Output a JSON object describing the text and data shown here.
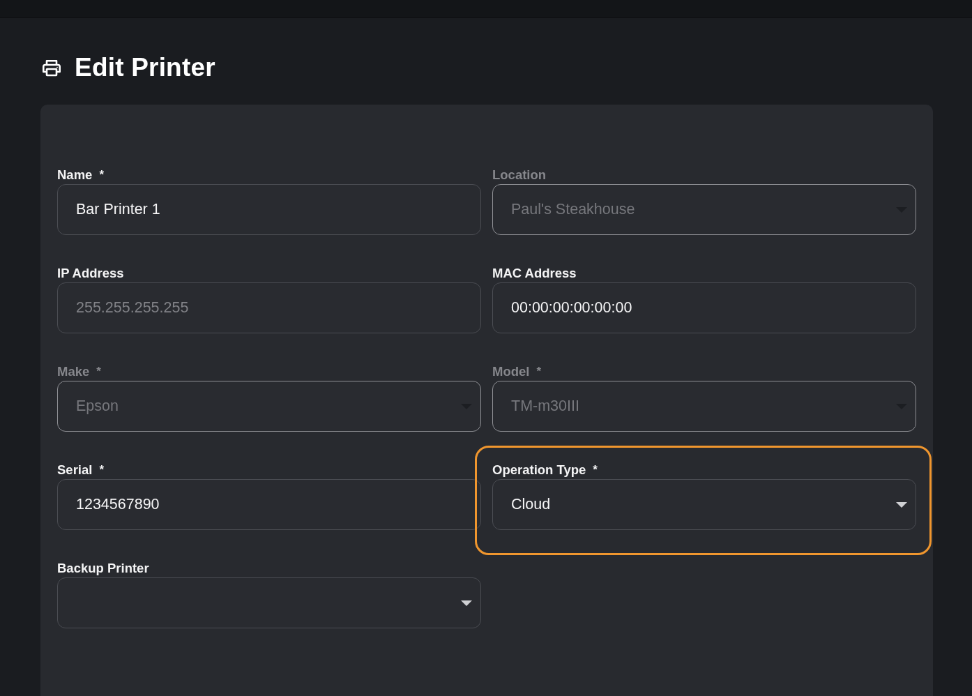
{
  "page": {
    "title": "Edit Printer"
  },
  "form": {
    "fields": [
      {
        "label": "Name",
        "required_mark": "*",
        "kind": "text",
        "value": "Bar Printer 1",
        "disabled": false,
        "highlighted": false
      },
      {
        "label": "Location",
        "kind": "select",
        "value": "Paul's Steakhouse",
        "disabled": true,
        "highlighted": false
      },
      {
        "label": "IP Address",
        "kind": "text",
        "placeholder": "255.255.255.255",
        "disabled": false,
        "highlighted": false
      },
      {
        "label": "MAC Address",
        "kind": "text",
        "value": "00:00:00:00:00:00",
        "disabled": false,
        "highlighted": false
      },
      {
        "label": "Make",
        "required_mark": "*",
        "kind": "select",
        "value": "Epson",
        "disabled": true,
        "highlighted": false
      },
      {
        "label": "Model",
        "required_mark": "*",
        "kind": "select",
        "value": "TM-m30III",
        "disabled": true,
        "highlighted": false
      },
      {
        "label": "Serial",
        "required_mark": "*",
        "kind": "text",
        "value": "1234567890",
        "disabled": false,
        "highlighted": false
      },
      {
        "label": "Operation Type",
        "required_mark": "*",
        "kind": "select",
        "value": "Cloud",
        "disabled": false,
        "highlighted": true
      },
      {
        "label": "Backup Printer",
        "kind": "select",
        "disabled": false,
        "highlighted": false
      }
    ]
  }
}
